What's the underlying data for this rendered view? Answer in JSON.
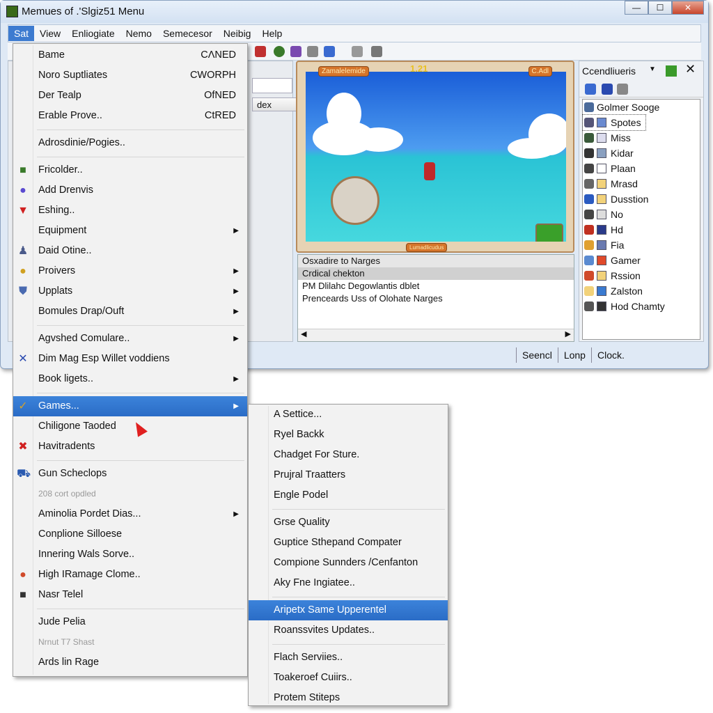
{
  "window": {
    "title": "Memues of .'Slgiz51 Menu",
    "minimize": "—",
    "maximize": "☐",
    "close": "✕"
  },
  "menubar": [
    "Sat",
    "View",
    "Enliogiate",
    "Nemo",
    "Semecesor",
    "Neibig",
    "Help"
  ],
  "game": {
    "score": "1.21",
    "badge_left": "Zamalelemide",
    "badge_right": "C.Adl",
    "bottom_label": "Lumadlicudus"
  },
  "left_pane": {
    "column_header": "dex"
  },
  "log": {
    "rows": [
      "Osxadire to Narges",
      "Crdical chekton",
      "PM Dlilahc Degowlantis dblet",
      "Prenceards Uss of Olohate Narges"
    ]
  },
  "right_panel": {
    "title": "Ccendliueris",
    "items": [
      {
        "label": "Golmer Sooge",
        "c1": "#4a6a9a",
        "c2": ""
      },
      {
        "label": "Spotes",
        "c1": "#557",
        "c2": "#6a8ad0"
      },
      {
        "label": "Miss",
        "c1": "#3a5a3a",
        "c2": "#dde"
      },
      {
        "label": "Kidar",
        "c1": "#333",
        "c2": "#8aa0c0"
      },
      {
        "label": "Plaan",
        "c1": "#444",
        "c2": "#fff"
      },
      {
        "label": "Mrasd",
        "c1": "#666",
        "c2": "#f2d27a"
      },
      {
        "label": "Dusstion",
        "c1": "#2a5ac0",
        "c2": "#f2d27a"
      },
      {
        "label": "No",
        "c1": "#444",
        "c2": "#ddd"
      },
      {
        "label": "Hd",
        "c1": "#c03020",
        "c2": "#2a3a8a"
      },
      {
        "label": "Fia",
        "c1": "#e0a030",
        "c2": "#6a7ab0"
      },
      {
        "label": "Gamer",
        "c1": "#5a8ad0",
        "c2": "#e04a2a"
      },
      {
        "label": "Rssion",
        "c1": "#d04a2a",
        "c2": "#f2d27a"
      },
      {
        "label": "Zalston",
        "c1": "#f2d27a",
        "c2": "#3a7ad0"
      },
      {
        "label": "Hod Chamty",
        "c1": "#555",
        "c2": "#333"
      }
    ]
  },
  "status": [
    "Seencl",
    "Lonp",
    "Clock."
  ],
  "main_menu": [
    {
      "label": "Bame",
      "shortcut": "CΛNED"
    },
    {
      "label": "Noro Suptliates",
      "shortcut": "CWORPH"
    },
    {
      "label": "Der Tealp",
      "shortcut": "OfNED"
    },
    {
      "label": "Erable Prove..",
      "shortcut": "CtRED"
    },
    {
      "sep": true
    },
    {
      "label": "Adrosdinie/Pogies.."
    },
    {
      "sep": true
    },
    {
      "label": "Fricolder..",
      "icon": "■",
      "color": "#3a7a2a"
    },
    {
      "label": "Add Drenvis",
      "icon": "●",
      "color": "#5a4ad0"
    },
    {
      "label": "Eshing..",
      "icon": "▼",
      "color": "#d02020"
    },
    {
      "label": "Equipment",
      "arrow": true
    },
    {
      "label": "Daid Otine..",
      "icon": "♟",
      "color": "#4a5a8a"
    },
    {
      "label": "Proivers",
      "arrow": true,
      "icon": "●",
      "color": "#d0a020"
    },
    {
      "label": "Upplats",
      "arrow": true,
      "icon": "⛊",
      "color": "#4a6ab0"
    },
    {
      "label": "Bomules Drap/Ouft",
      "arrow": true
    },
    {
      "sep": true
    },
    {
      "label": "Agvshed Comulare..",
      "arrow": true
    },
    {
      "label": "Dim Mag Esp Willet voddiens",
      "icon": "✕",
      "color": "#2a4ab0"
    },
    {
      "label": "Book ligets..",
      "arrow": true
    },
    {
      "sep": true
    },
    {
      "label": "Games...",
      "arrow": true,
      "highlight": true,
      "icon": "✓",
      "color": "#d0a030"
    },
    {
      "label": "Chiligone Taoded"
    },
    {
      "label": "Havitradents",
      "icon": "✖",
      "color": "#d02020"
    },
    {
      "sep": true
    },
    {
      "label": "Gun Scheclops",
      "icon": "⛟",
      "color": "#2a5ab0"
    },
    {
      "label": "208 cort opdled",
      "disabled": true
    },
    {
      "label": "Aminolia Pordet Dias...",
      "arrow": true
    },
    {
      "label": "Conplione Silloese"
    },
    {
      "label": "Innering Wals Sorve.."
    },
    {
      "label": "High IRamage Clome..",
      "icon": "●",
      "color": "#d04a2a"
    },
    {
      "label": "Nasr Telel",
      "icon": "■",
      "color": "#333"
    },
    {
      "sep": true
    },
    {
      "label": "Jude Pelia"
    },
    {
      "label": "Nrnut T7 Shast",
      "disabled": true
    },
    {
      "label": "Ards lin Rage"
    }
  ],
  "sub_menu": [
    {
      "label": "A Settice..."
    },
    {
      "label": "Ryel Backk"
    },
    {
      "label": "Chadget For Sture."
    },
    {
      "label": "Prujral Traatters"
    },
    {
      "label": "Engle Podel"
    },
    {
      "sep": true
    },
    {
      "label": "Grse Quality"
    },
    {
      "label": "Guptice Sthepand Compater"
    },
    {
      "label": "Compione Sunnders /Cenfanton"
    },
    {
      "label": "Aky Fne Ingiatee.."
    },
    {
      "sep": true
    },
    {
      "label": "Aripetx Same Upperentel",
      "highlight": true
    },
    {
      "label": "Roanssvites Updates.."
    },
    {
      "sep": true
    },
    {
      "label": "Flach Serviies.."
    },
    {
      "label": "Toakeroef Cuiirs.."
    },
    {
      "label": "Protem Stiteps"
    }
  ],
  "colors": {
    "accent": "#2a6cc6",
    "menu_bg": "#f2f2f2",
    "window_bg": "#dfe9f5"
  }
}
